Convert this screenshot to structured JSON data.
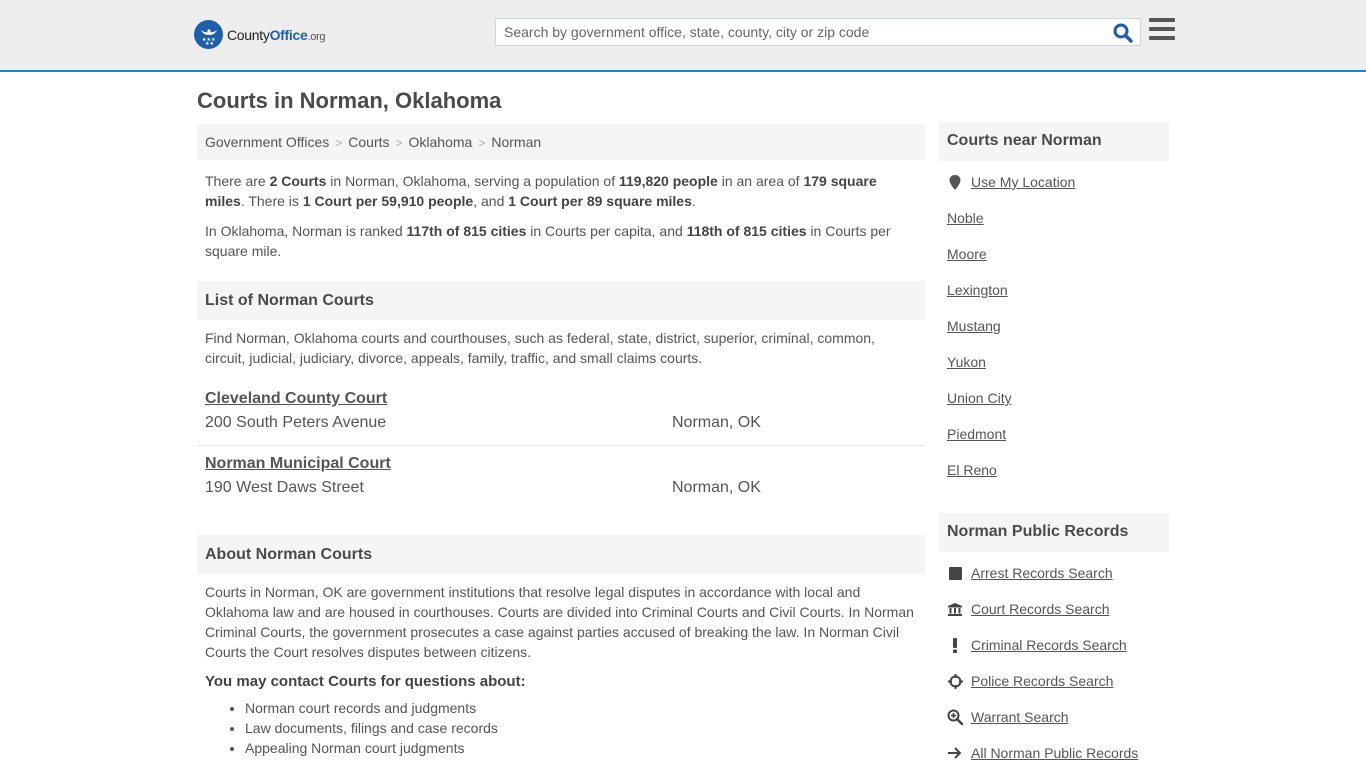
{
  "header": {
    "logo": {
      "name_part1": "County",
      "name_part2": "Office",
      "name_part3": ".org"
    },
    "search": {
      "placeholder": "Search by government office, state, county, city or zip code",
      "value": ""
    }
  },
  "page": {
    "title": "Courts in Norman, Oklahoma"
  },
  "breadcrumb": [
    {
      "label": "Government Offices"
    },
    {
      "label": "Courts"
    },
    {
      "label": "Oklahoma"
    },
    {
      "label": "Norman"
    }
  ],
  "summary": {
    "p1": {
      "t1": "There are ",
      "b1": "2 Courts",
      "t2": " in Norman, Oklahoma, serving a population of ",
      "b2": "119,820 people",
      "t3": " in an area of ",
      "b3": "179 square miles",
      "t4": ". There is ",
      "b4": "1 Court per 59,910 people",
      "t5": ", and ",
      "b5": "1 Court per 89 square miles",
      "t6": "."
    },
    "p2": {
      "t1": "In Oklahoma, Norman is ranked ",
      "b1": "117th of 815 cities",
      "t2": " in Courts per capita, and ",
      "b2": "118th of 815 cities",
      "t3": " in Courts per square mile."
    }
  },
  "list_section": {
    "heading": "List of Norman Courts",
    "intro": "Find Norman, Oklahoma courts and courthouses, such as federal, state, district, superior, criminal, common, circuit, judicial, judiciary, divorce, appeals, family, traffic, and small claims courts.",
    "courts": [
      {
        "name": "Cleveland County Court",
        "address": "200 South Peters Avenue",
        "city": "Norman, OK"
      },
      {
        "name": "Norman Municipal Court",
        "address": "190 West Daws Street",
        "city": "Norman, OK"
      }
    ]
  },
  "about_section": {
    "heading": "About Norman Courts",
    "body": "Courts in Norman, OK are government institutions that resolve legal disputes in accordance with local and Oklahoma law and are housed in courthouses. Courts are divided into Criminal Courts and Civil Courts. In Norman Criminal Courts, the government prosecutes a case against parties accused of breaking the law. In Norman Civil Courts the Court resolves disputes between citizens.",
    "contact_heading": "You may contact Courts for questions about:",
    "topics": [
      "Norman court records and judgments",
      "Law documents, filings and case records",
      "Appealing Norman court judgments"
    ]
  },
  "sidebar": {
    "nearby": {
      "heading": "Courts near Norman",
      "use_location": "Use My Location",
      "cities": [
        "Noble",
        "Moore",
        "Lexington",
        "Mustang",
        "Yukon",
        "Union City",
        "Piedmont",
        "El Reno"
      ]
    },
    "records": {
      "heading": "Norman Public Records",
      "links": [
        {
          "label": "Arrest Records Search",
          "icon": "square-icon"
        },
        {
          "label": "Court Records Search",
          "icon": "courthouse-icon"
        },
        {
          "label": "Criminal Records Search",
          "icon": "exclamation-icon"
        },
        {
          "label": "Police Records Search",
          "icon": "crosshair-icon"
        },
        {
          "label": "Warrant Search",
          "icon": "zoom-in-icon"
        },
        {
          "label": "All Norman Public Records",
          "icon": "arrow-right-icon"
        }
      ]
    }
  }
}
